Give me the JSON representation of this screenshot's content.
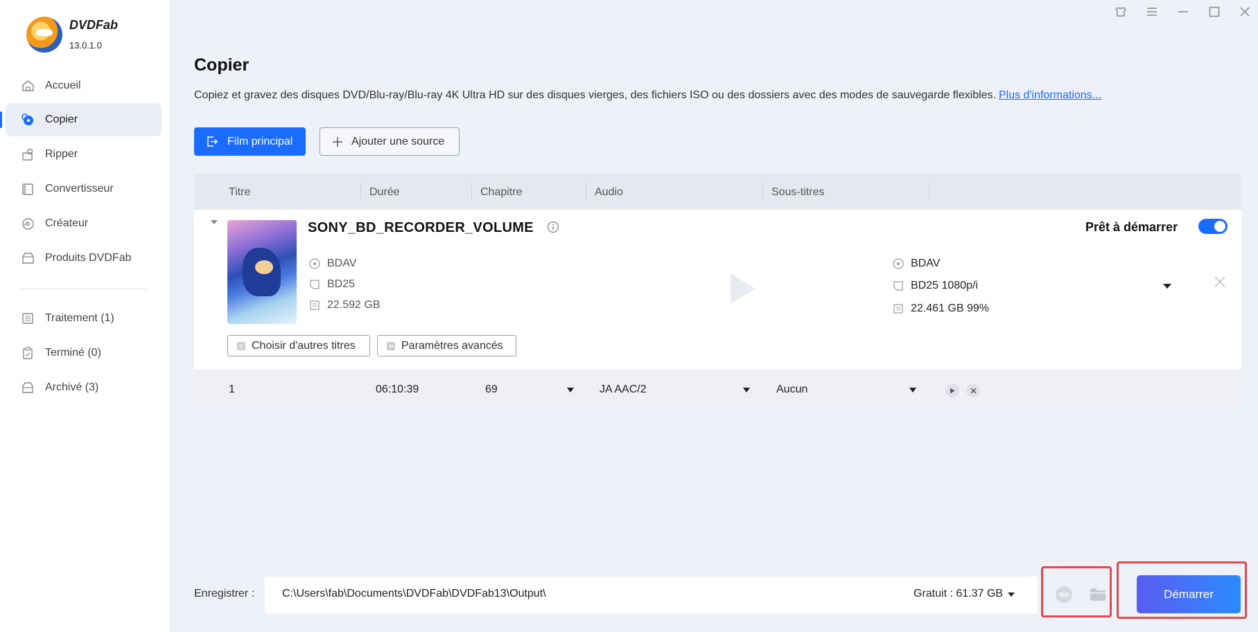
{
  "app": {
    "brand": "DVDFab",
    "version": "13.0.1.0"
  },
  "sidebar": {
    "items": [
      {
        "label": "Accueil",
        "icon": "home-icon"
      },
      {
        "label": "Copier",
        "icon": "copy-icon",
        "active": true
      },
      {
        "label": "Ripper",
        "icon": "ripper-icon"
      },
      {
        "label": "Convertisseur",
        "icon": "converter-icon"
      },
      {
        "label": "Créateur",
        "icon": "creator-icon"
      },
      {
        "label": "Produits DVDFab",
        "icon": "products-icon"
      }
    ],
    "queue": [
      {
        "label": "Traitement (1)",
        "icon": "processing-icon"
      },
      {
        "label": "Terminé (0)",
        "icon": "finished-icon"
      },
      {
        "label": "Archivé (3)",
        "icon": "archive-icon"
      }
    ]
  },
  "main": {
    "title": "Copier",
    "description": "Copiez et gravez des disques DVD/Blu-ray/Blu-ray 4K Ultra HD sur des disques vierges, des fichiers ISO ou des dossiers avec des modes de sauvegarde flexibles.",
    "more_link": "Plus d'informations...",
    "mode_button": "Film principal",
    "add_source_button": "Ajouter une source",
    "columns": [
      "Titre",
      "Durée",
      "Chapitre",
      "Audio",
      "Sous-titres"
    ]
  },
  "disc": {
    "title": "SONY_BD_RECORDER_VOLUME",
    "source": {
      "format": "BDAV",
      "disc_type": "BD25",
      "size": "22.592 GB"
    },
    "status": "Prêt à démarrer",
    "enabled": true,
    "output": {
      "format": "BDAV",
      "disc_type": "BD25 1080p/i",
      "size": "22.461 GB 99%"
    },
    "choose_titles_button": "Choisir d'autres titres",
    "advanced_button": "Paramètres avancés"
  },
  "title_row": {
    "number": "1",
    "duration": "06:10:39",
    "chapters": "69",
    "audio": "JA  AAC/2",
    "subtitles": "Aucun"
  },
  "footer": {
    "save_label": "Enregistrer :",
    "path": "C:\\Users\\fab\\Documents\\DVDFab\\DVDFab13\\Output\\",
    "free_space": "Gratuit : 61.37 GB",
    "iso_label": "ISO",
    "start_button": "Démarrer"
  },
  "colors": {
    "accent": "#1a6cff",
    "highlight": "#e5484d"
  }
}
